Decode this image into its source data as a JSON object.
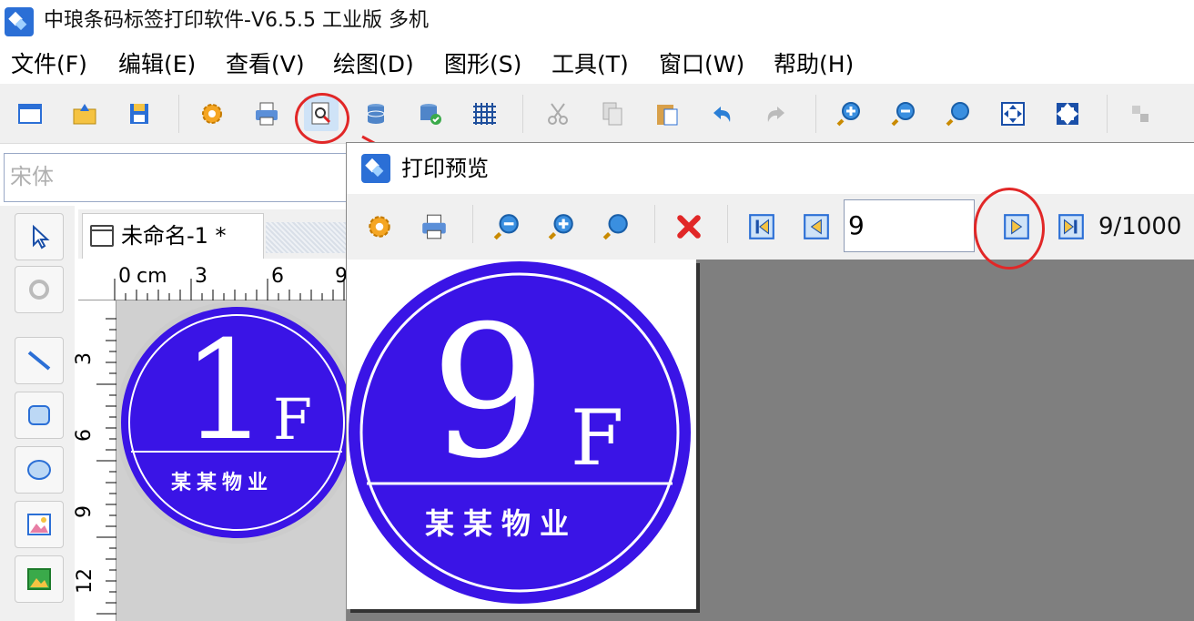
{
  "app": {
    "title": "中琅条码标签打印软件-V6.5.5 工业版 多机"
  },
  "menu": [
    "文件(F)",
    "编辑(E)",
    "查看(V)",
    "绘图(D)",
    "图形(S)",
    "工具(T)",
    "窗口(W)",
    "帮助(H)"
  ],
  "font": {
    "name": "宋体"
  },
  "document": {
    "tab_title": "未命名-1 *"
  },
  "ruler": {
    "unit": "cm",
    "h_ticks": [
      "0",
      "3",
      "6",
      "9"
    ],
    "v_ticks": [
      "3",
      "6",
      "9",
      "12"
    ]
  },
  "label_design": {
    "number": "1",
    "suffix": "F",
    "org": "某某物业",
    "fill_color": "#3a14e6"
  },
  "preview": {
    "title": "打印预览",
    "page_input": "9",
    "page_count": "9/1000",
    "label": {
      "number": "9",
      "suffix": "F",
      "org": "某某物业"
    }
  },
  "icons": {
    "toolbar": [
      "new-icon",
      "open-icon",
      "save-icon",
      "settings-icon",
      "print-icon",
      "print-preview-icon",
      "database-icon",
      "database-settings-icon",
      "grid-icon",
      "cut-icon",
      "copy-icon",
      "paste-icon",
      "undo-icon",
      "redo-icon",
      "zoom-in-icon",
      "zoom-out-icon",
      "zoom-reset-icon",
      "fit-icon",
      "fit-page-icon"
    ],
    "annotation_color": "#e12727"
  }
}
